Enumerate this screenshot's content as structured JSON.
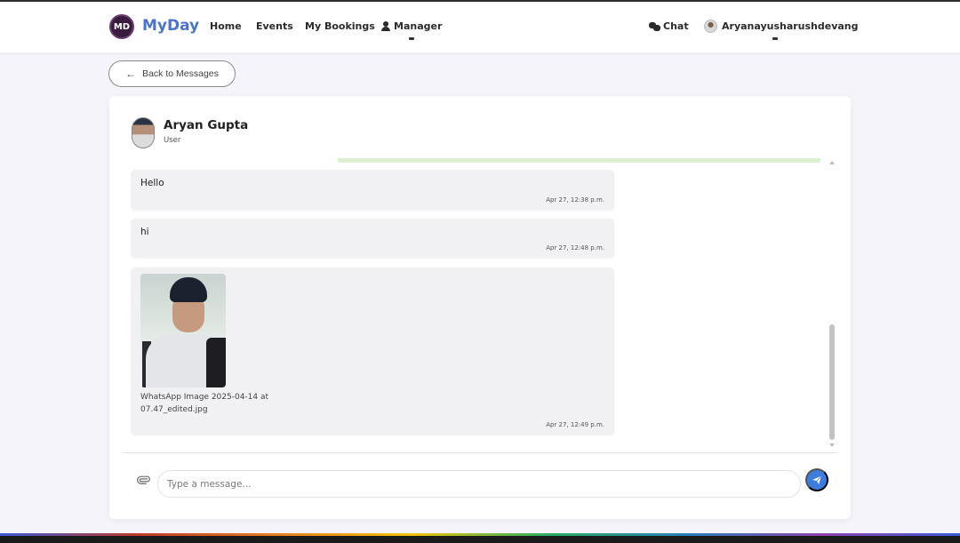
{
  "navbar": {
    "logo_text": "MD",
    "brand": "MyDay",
    "links": {
      "home": "Home",
      "events": "Events",
      "bookings": "My Bookings",
      "manager": "Manager"
    },
    "chat": "Chat",
    "username": "Aryanayusharushdevang"
  },
  "back_button": {
    "label": "Back to Messages"
  },
  "contact": {
    "name": "Aryan Gupta",
    "role": "User"
  },
  "messages": [
    {
      "text": "Hello",
      "time": "Apr 27, 12:38 p.m."
    },
    {
      "text": "hi",
      "time": "Apr 27, 12:48 p.m."
    },
    {
      "attachment_name": "WhatsApp Image 2025-04-14 at 07.47_edited.jpg",
      "time": "Apr 27, 12:49 p.m."
    }
  ],
  "composer": {
    "placeholder": "Type a message..."
  },
  "colors": {
    "brand": "#4b74c9",
    "send_button": "#3d7ddf",
    "message_bubble": "#f1f1f3"
  },
  "icons": [
    "person-icon",
    "chat-icon",
    "arrow-left-icon",
    "paperclip-icon",
    "send-icon"
  ]
}
